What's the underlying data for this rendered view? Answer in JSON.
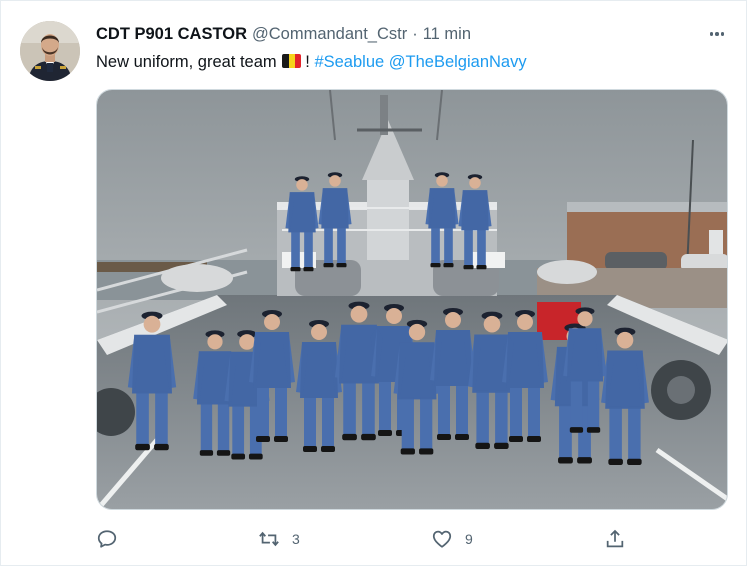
{
  "tweet": {
    "display_name": "CDT P901 CASTOR",
    "handle": "@Commandant_Cstr",
    "separator": "·",
    "time": "11 min",
    "text_prefix": "New uniform, great team",
    "text_suffix": "!",
    "hashtag": "#Seablue",
    "mention": "@TheBelgianNavy"
  },
  "flag_colors": [
    "#1a1a1a",
    "#f6d31b",
    "#e3242b"
  ],
  "actions": {
    "reply": {
      "icon": "reply-icon",
      "count": ""
    },
    "retweet": {
      "icon": "retweet-icon",
      "count": "3"
    },
    "like": {
      "icon": "heart-icon",
      "count": "9"
    },
    "share": {
      "icon": "share-icon",
      "count": ""
    }
  },
  "colors": {
    "link": "#1d9bf0",
    "secondary_text": "#536471",
    "uniform": "#4a6fae"
  }
}
